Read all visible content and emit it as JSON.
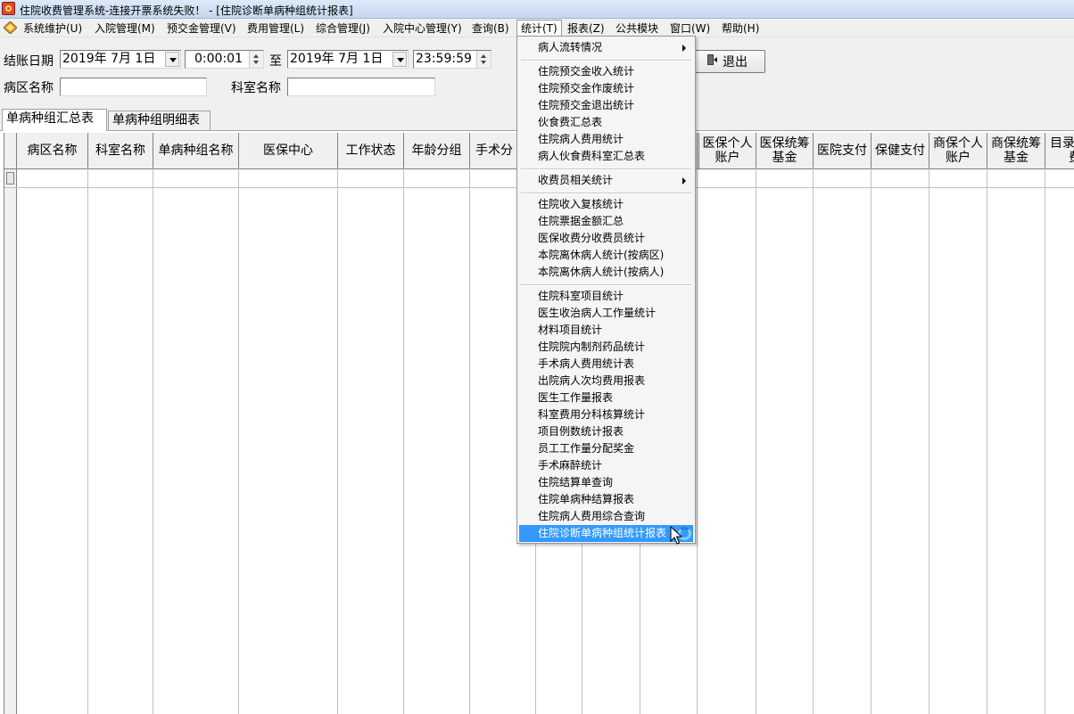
{
  "window": {
    "title": "住院收费管理系统-连接开票系统失败！ - [住院诊断单病种组统计报表]"
  },
  "menubar": {
    "items": [
      {
        "label": "系统维护(U)"
      },
      {
        "label": "入院管理(M)"
      },
      {
        "label": "预交金管理(V)"
      },
      {
        "label": "费用管理(L)"
      },
      {
        "label": "综合管理(J)"
      },
      {
        "label": "入院中心管理(Y)"
      },
      {
        "label": "查询(B)"
      },
      {
        "label": "统计(T)"
      },
      {
        "label": "报表(Z)"
      },
      {
        "label": "公共模块"
      },
      {
        "label": "窗口(W)"
      },
      {
        "label": "帮助(H)"
      }
    ]
  },
  "filter": {
    "date_label": "结账日期",
    "start_date": "2019年 7月 1日",
    "start_time": "0:00:01",
    "to_label": "至",
    "end_date": "2019年 7月 1日",
    "end_time": "23:59:59",
    "exit_label": "退出",
    "ward_label": "病区名称",
    "ward_value": "",
    "dept_label": "科室名称",
    "dept_value": ""
  },
  "tabs": [
    {
      "label": "单病种组汇总表"
    },
    {
      "label": "单病种组明细表"
    }
  ],
  "grid": {
    "columns": [
      "病区名称",
      "科室名称",
      "单病种组名称",
      "医保中心",
      "工作状态",
      "年龄分组",
      "手术分",
      "",
      "",
      "",
      "",
      "医保个人账户",
      "医保统筹基金",
      "医院支付",
      "保健支付",
      "商保个人账户",
      "商保统筹基金",
      "目录外自费"
    ]
  },
  "stats_menu": {
    "items": [
      {
        "label": "病人流转情况",
        "submenu": true
      },
      {
        "separator": true
      },
      {
        "label": "住院预交金收入统计"
      },
      {
        "label": "住院预交金作废统计"
      },
      {
        "label": "住院预交金退出统计"
      },
      {
        "label": "伙食费汇总表"
      },
      {
        "label": "住院病人费用统计"
      },
      {
        "label": "病人伙食费科室汇总表"
      },
      {
        "separator": true
      },
      {
        "label": "收费员相关统计",
        "submenu": true
      },
      {
        "separator": true
      },
      {
        "label": "住院收入复核统计"
      },
      {
        "label": "住院票据金额汇总"
      },
      {
        "label": "医保收费分收费员统计"
      },
      {
        "label": "本院离休病人统计(按病区)"
      },
      {
        "label": "本院离休病人统计(按病人)"
      },
      {
        "separator": true
      },
      {
        "label": "住院科室项目统计"
      },
      {
        "label": "医生收治病人工作量统计"
      },
      {
        "label": "材料项目统计"
      },
      {
        "label": "住院院内制剂药品统计"
      },
      {
        "label": "手术病人费用统计表"
      },
      {
        "label": "出院病人次均费用报表"
      },
      {
        "label": "医生工作量报表"
      },
      {
        "label": "科室费用分科核算统计"
      },
      {
        "label": "项目例数统计报表"
      },
      {
        "label": "员工工作量分配奖金"
      },
      {
        "label": "手术麻醉统计"
      },
      {
        "label": "住院结算单查询"
      },
      {
        "label": "住院单病种结算报表"
      },
      {
        "label": "住院病人费用综合查询"
      },
      {
        "label": "住院诊断单病种组统计报表",
        "highlighted": true
      }
    ]
  },
  "colors": {
    "highlight": "#3399ff",
    "titlebar": "#c4d8ef"
  }
}
